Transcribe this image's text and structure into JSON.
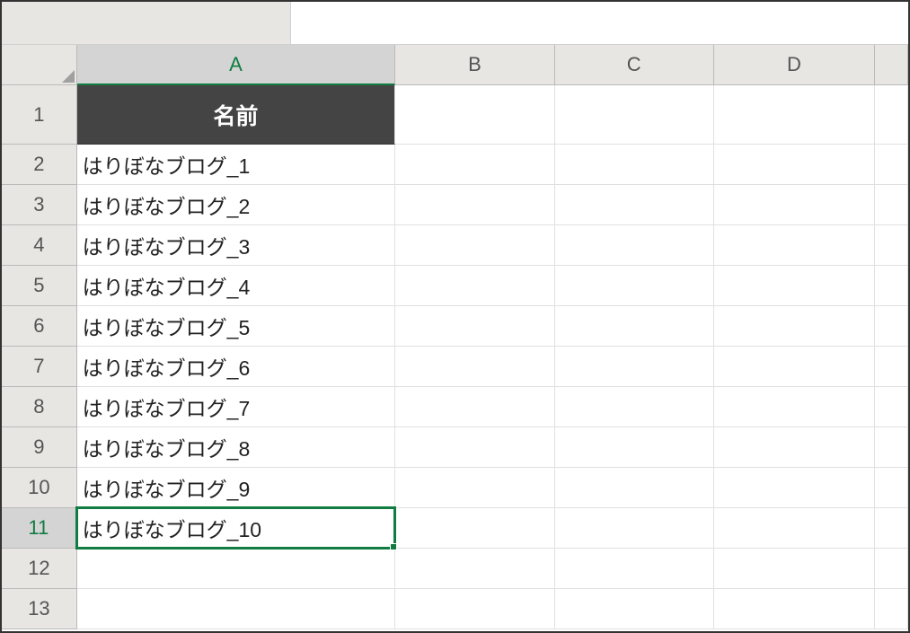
{
  "columns": [
    "A",
    "B",
    "C",
    "D"
  ],
  "rows": [
    "1",
    "2",
    "3",
    "4",
    "5",
    "6",
    "7",
    "8",
    "9",
    "10",
    "11",
    "12",
    "13"
  ],
  "selected_cell": {
    "row": 11,
    "col": "A"
  },
  "selected_col": "A",
  "selected_row": "11",
  "table": {
    "header": "名前",
    "values": [
      "はりぼなブログ_1",
      "はりぼなブログ_2",
      "はりぼなブログ_3",
      "はりぼなブログ_4",
      "はりぼなブログ_5",
      "はりぼなブログ_6",
      "はりぼなブログ_7",
      "はりぼなブログ_8",
      "はりぼなブログ_9",
      "はりぼなブログ_10"
    ]
  },
  "formula_bar": ""
}
